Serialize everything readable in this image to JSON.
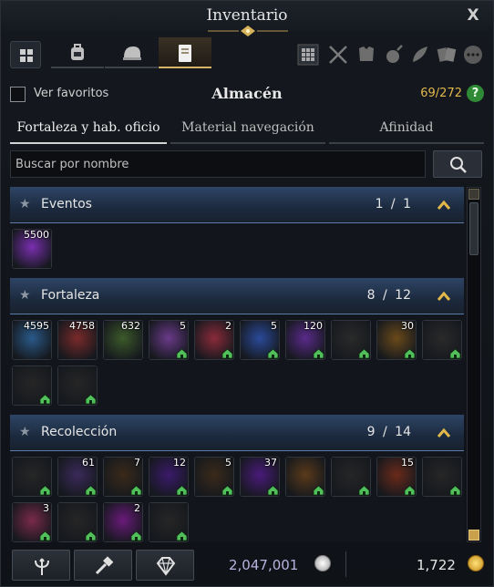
{
  "window": {
    "title": "Inventario",
    "close_label": "X"
  },
  "top_tabs": [
    "equipment-tab",
    "consumables-tab",
    "housing-tab",
    "storage-tab"
  ],
  "favorites": {
    "label": "Ver favoritos",
    "checked": false
  },
  "storage": {
    "title": "Almacén",
    "count": "69/272",
    "help_label": "?"
  },
  "sub_tabs": [
    {
      "label": "Fortaleza y hab. oficio",
      "active": true
    },
    {
      "label": "Material navegación",
      "active": false
    },
    {
      "label": "Afinidad",
      "active": false
    }
  ],
  "search": {
    "placeholder": "Buscar por nombre"
  },
  "sections": [
    {
      "name": "Eventos",
      "count": "1 / 1",
      "items": [
        {
          "qty": "5500",
          "color": "#7a2fb0",
          "home": false
        }
      ]
    },
    {
      "name": "Fortaleza",
      "count": "8 / 12",
      "items": [
        {
          "qty": "4595",
          "color": "#2a5a8a",
          "home": false
        },
        {
          "qty": "4758",
          "color": "#7a2a2a",
          "home": false
        },
        {
          "qty": "632",
          "color": "#3c5a2a",
          "home": false
        },
        {
          "qty": "5",
          "color": "#6a3a8a",
          "home": true
        },
        {
          "qty": "2",
          "color": "#8a2a3a",
          "home": true
        },
        {
          "qty": "5",
          "color": "#2a4a9a",
          "home": true
        },
        {
          "qty": "120",
          "color": "#5a2a8a",
          "home": true
        },
        {
          "qty": "",
          "color": "#2a2a2a",
          "home": true
        },
        {
          "qty": "30",
          "color": "#6a4a1a",
          "home": true
        },
        {
          "qty": "",
          "color": "#2a2a2a",
          "home": true
        },
        {
          "qty": "",
          "color": "#262626",
          "home": true
        },
        {
          "qty": "",
          "color": "#262626",
          "home": true
        }
      ]
    },
    {
      "name": "Recolección",
      "count": "9 / 14",
      "items": [
        {
          "qty": "",
          "color": "#262626",
          "home": true
        },
        {
          "qty": "61",
          "color": "#3a2a5a",
          "home": true
        },
        {
          "qty": "7",
          "color": "#3a2a1a",
          "home": true
        },
        {
          "qty": "12",
          "color": "#3a1a6a",
          "home": true
        },
        {
          "qty": "5",
          "color": "#3a2a1a",
          "home": true
        },
        {
          "qty": "37",
          "color": "#4a1a7a",
          "home": true
        },
        {
          "qty": "",
          "color": "#5a3a1a",
          "home": true
        },
        {
          "qty": "",
          "color": "#262626",
          "home": true
        },
        {
          "qty": "15",
          "color": "#6a2a1a",
          "home": true
        },
        {
          "qty": "",
          "color": "#262626",
          "home": true
        },
        {
          "qty": "3",
          "color": "#7a2a4a",
          "home": true
        },
        {
          "qty": "",
          "color": "#262626",
          "home": true
        },
        {
          "qty": "2",
          "color": "#6a1a7a",
          "home": true
        },
        {
          "qty": "",
          "color": "#262626",
          "home": true
        }
      ]
    }
  ],
  "currency": {
    "silver": "2,047,001",
    "gold": "1,722"
  },
  "bottom_buttons": [
    "repair-icon",
    "dismantle-icon",
    "gem-icon"
  ]
}
